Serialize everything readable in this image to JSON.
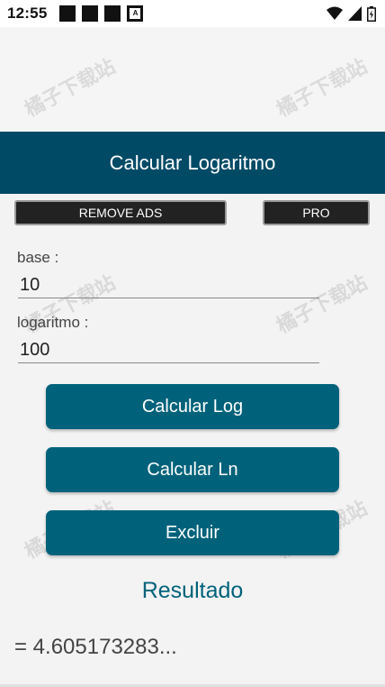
{
  "status_bar": {
    "time": "12:55",
    "notification_letter": "A",
    "icons": [
      "notification-square-icon",
      "notification-square-icon",
      "notification-square-icon",
      "app-notification-icon"
    ],
    "system_icons": [
      "wifi-icon",
      "signal-icon",
      "battery-icon"
    ]
  },
  "watermark": "橘子下载站",
  "header": {
    "title": "Calcular Logaritmo",
    "background": "#004a66"
  },
  "top_buttons": {
    "remove_ads": "REMOVE ADS",
    "pro": "PRO"
  },
  "form": {
    "base_label": "base :",
    "base_value": "10",
    "log_label": "logaritmo :",
    "log_value": "100"
  },
  "actions": {
    "calc_log": "Calcular Log",
    "calc_ln": "Calcular Ln",
    "delete": "Excluir",
    "accent": "#00627a"
  },
  "result": {
    "title": "Resultado",
    "value": "= 4.605173283..."
  }
}
